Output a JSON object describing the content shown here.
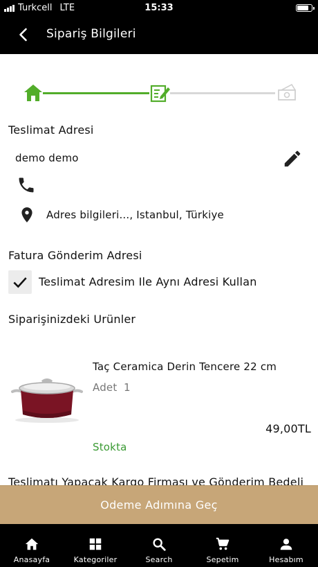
{
  "status": {
    "carrier": "Turkcell",
    "network": "LTE",
    "time": "15:33",
    "battery_level": 0.85
  },
  "header": {
    "title": "Sipariş Bilgileri",
    "back_icon": "chevron-left-icon"
  },
  "steps": {
    "icons": [
      "home-icon",
      "edit-form-icon",
      "payment-icon"
    ],
    "colors": {
      "done": "#52ad2a",
      "todo": "#d8d8d8"
    }
  },
  "delivery": {
    "title": "Teslimat Adresi",
    "name": "demo demo",
    "address": "Adres bilgileri..., Istanbul, Türkiye"
  },
  "billing": {
    "title": "Fatura Gönderim Adresi",
    "same_address_label": "Teslimat Adresim Ile Aynı Adresi Kullan",
    "same_address_checked": true
  },
  "products": {
    "title": "Siparişinizdeki Urünler",
    "items": [
      {
        "name": "Taç Ceramica Derin Tencere 22 cm",
        "qty_label": "Adet",
        "qty": "1",
        "price": "49,00TL",
        "stock": "Stokta"
      }
    ]
  },
  "shipping": {
    "title": "Teslimatı Yapacak Kargo Firması ve Gönderim Bedeli"
  },
  "cta": {
    "label": "Odeme Adımına Geç",
    "color": "#c7a678"
  },
  "tabs": [
    {
      "label": "Anasayfa",
      "icon": "home-icon"
    },
    {
      "label": "Kategoriler",
      "icon": "grid-icon"
    },
    {
      "label": "Search",
      "icon": "search-icon"
    },
    {
      "label": "Sepetim",
      "icon": "cart-icon"
    },
    {
      "label": "Hesabım",
      "icon": "person-icon"
    }
  ]
}
